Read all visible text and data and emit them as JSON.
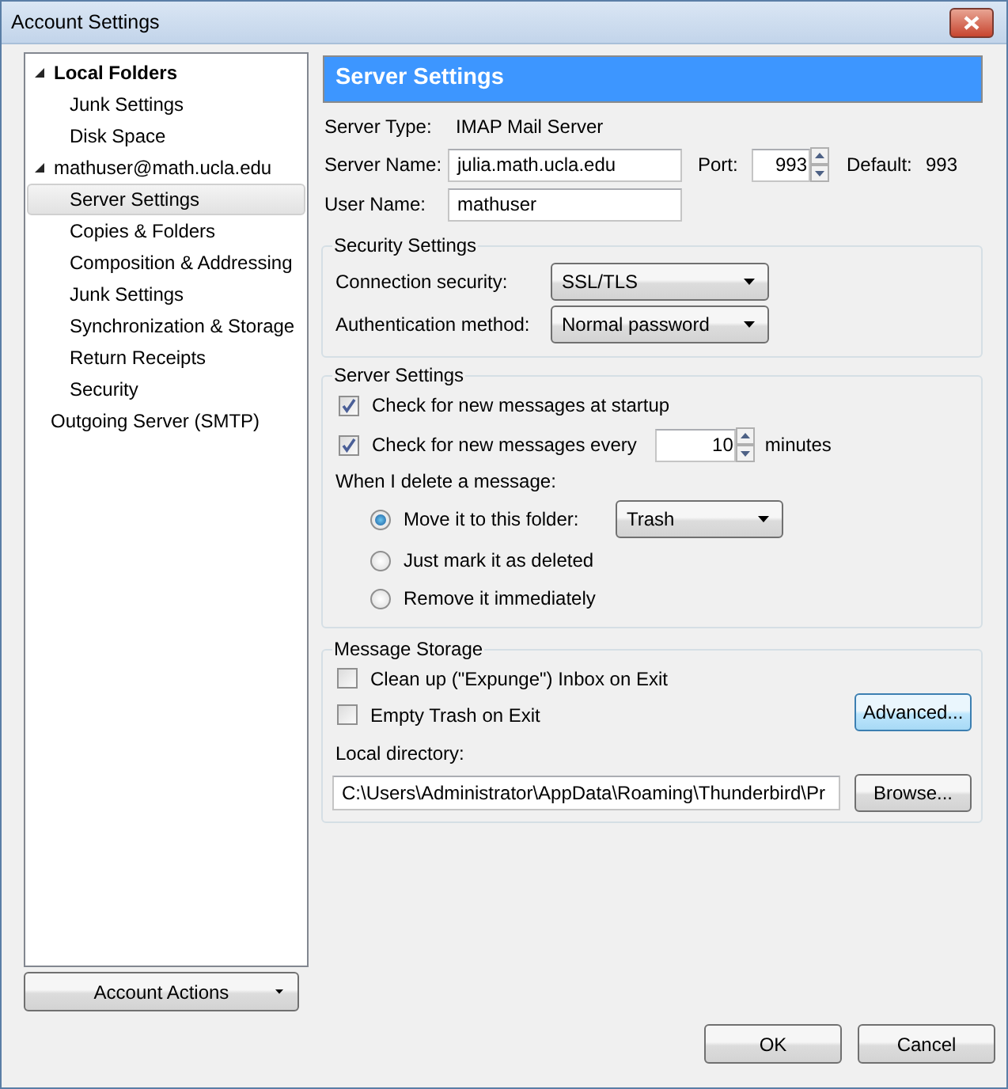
{
  "window": {
    "title": "Account Settings"
  },
  "sidebar": {
    "tree": [
      {
        "label": "Local Folders",
        "bold": true,
        "expanded": true,
        "selected": false,
        "children": [
          {
            "label": "Junk Settings",
            "selected": false
          },
          {
            "label": "Disk Space",
            "selected": false
          }
        ]
      },
      {
        "label": "mathuser@math.ucla.edu",
        "bold": false,
        "expanded": true,
        "selected": false,
        "children": [
          {
            "label": "Server Settings",
            "selected": true
          },
          {
            "label": "Copies & Folders",
            "selected": false
          },
          {
            "label": "Composition & Addressing",
            "selected": false
          },
          {
            "label": "Junk Settings",
            "selected": false
          },
          {
            "label": "Synchronization & Storage",
            "selected": false
          },
          {
            "label": "Return Receipts",
            "selected": false
          },
          {
            "label": "Security",
            "selected": false
          }
        ]
      },
      {
        "label": "Outgoing Server (SMTP)",
        "bold": false,
        "selected": false
      }
    ],
    "account_actions": "Account Actions"
  },
  "panel": {
    "title": "Server Settings",
    "server_type": {
      "label": "Server Type:",
      "value": "IMAP Mail Server"
    },
    "server_name": {
      "label": "Server Name:",
      "value": "julia.math.ucla.edu"
    },
    "port": {
      "label": "Port:",
      "value": "993"
    },
    "default": {
      "label": "Default:",
      "value": "993"
    },
    "user_name": {
      "label": "User Name:",
      "value": "mathuser"
    },
    "security": {
      "legend": "Security Settings",
      "connection_security": {
        "label": "Connection security:",
        "value": "SSL/TLS"
      },
      "authentication": {
        "label": "Authentication method:",
        "value": "Normal password"
      }
    },
    "server_settings": {
      "legend": "Server Settings",
      "check_startup": {
        "label": "Check for new messages at startup",
        "checked": true
      },
      "check_every": {
        "label": "Check for new messages every",
        "checked": true,
        "value": "10",
        "unit": "minutes"
      },
      "delete_label": "When I delete a message:",
      "delete_options": [
        {
          "label": "Move it to this folder:",
          "selected": true,
          "folder": "Trash"
        },
        {
          "label": "Just mark it as deleted",
          "selected": false
        },
        {
          "label": "Remove it immediately",
          "selected": false
        }
      ]
    },
    "storage": {
      "legend": "Message Storage",
      "options": [
        {
          "label": "Clean up (\"Expunge\") Inbox on Exit",
          "checked": false
        },
        {
          "label": "Empty Trash on Exit",
          "checked": false
        }
      ],
      "advanced_button": "Advanced...",
      "local_directory_label": "Local directory:",
      "local_directory": "C:\\Users\\Administrator\\AppData\\Roaming\\Thunderbird\\Pr",
      "browse_button": "Browse..."
    }
  },
  "buttons": [
    "OK",
    "Cancel"
  ]
}
